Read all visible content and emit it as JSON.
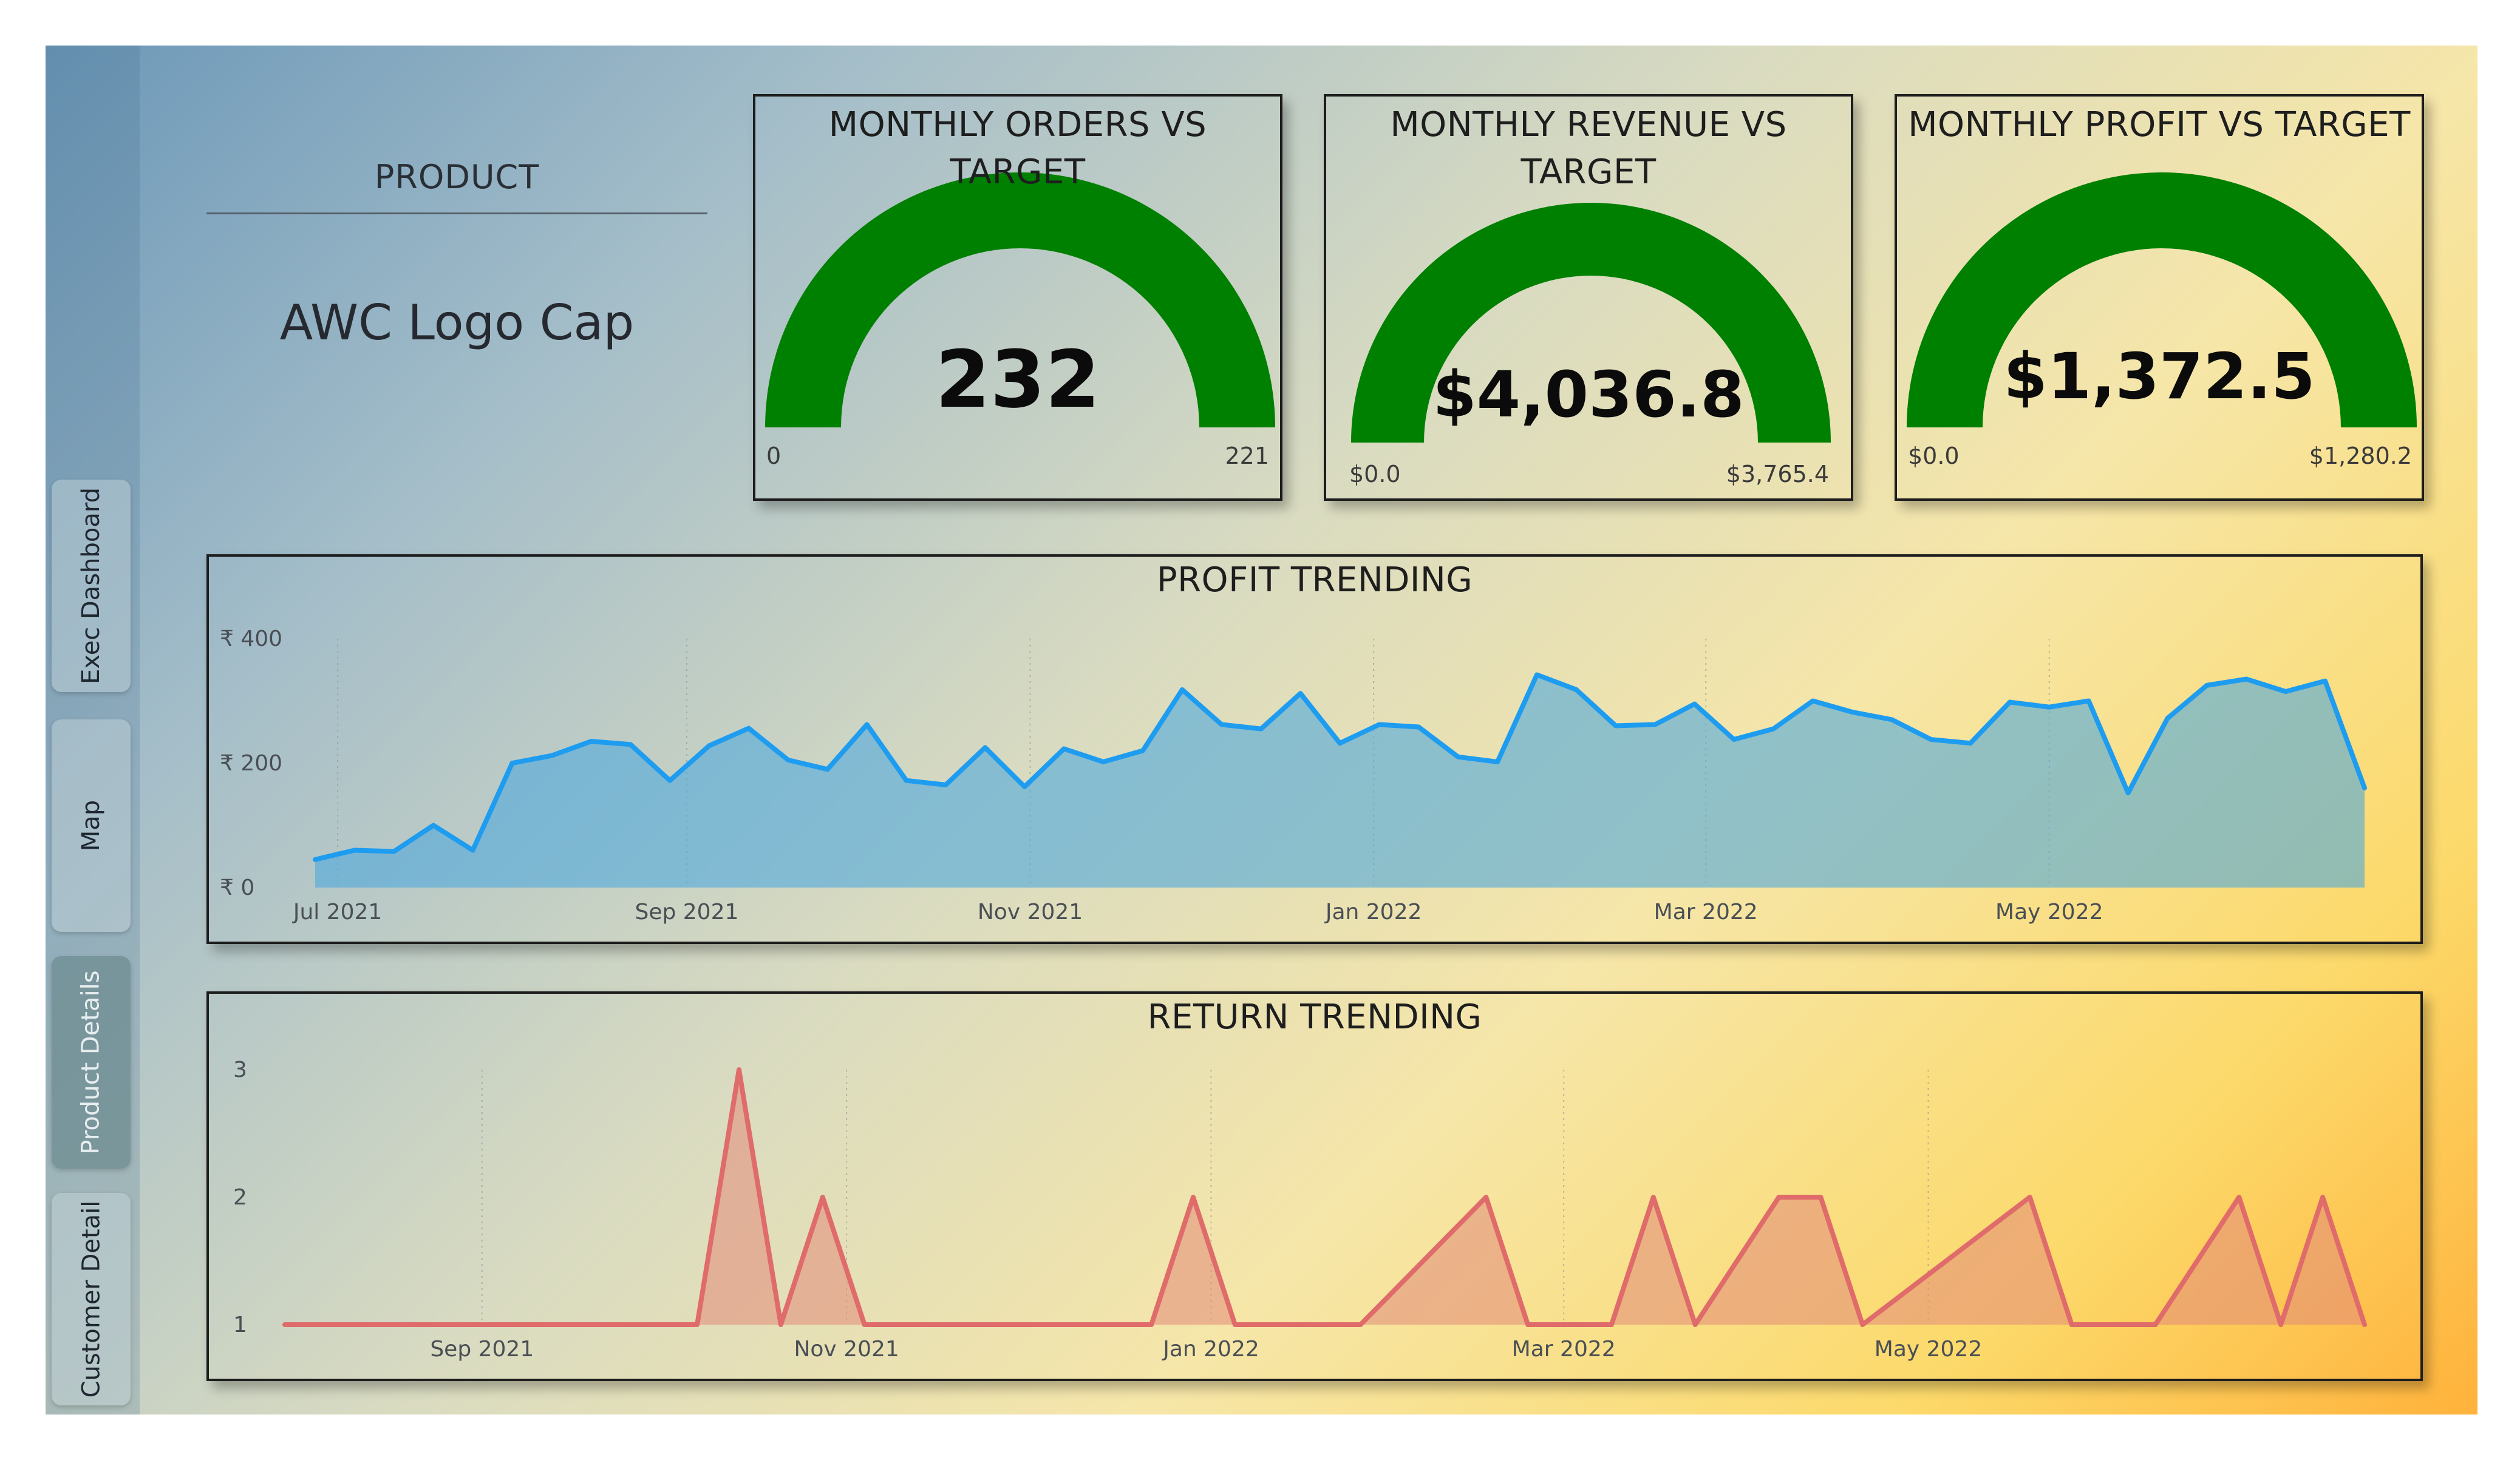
{
  "nav": {
    "items": [
      {
        "label": "Exec Dashboard",
        "active": false
      },
      {
        "label": "Map",
        "active": false
      },
      {
        "label": "Product Details",
        "active": true
      },
      {
        "label": "Customer Detail",
        "active": false
      }
    ]
  },
  "product": {
    "label": "PRODUCT",
    "value": "AWC Logo Cap"
  },
  "gauges": [
    {
      "title": "MONTHLY ORDERS VS TARGET",
      "value_text": "232",
      "min_text": "0",
      "max_text": "221",
      "fill_fraction": 1.0,
      "color": "#008000"
    },
    {
      "title": "MONTHLY REVENUE VS TARGET",
      "value_text": "$4,036.8",
      "min_text": "$0.0",
      "max_text": "$3,765.4",
      "fill_fraction": 1.0,
      "color": "#008000"
    },
    {
      "title": "MONTHLY PROFIT VS TARGET",
      "value_text": "$1,372.5",
      "min_text": "$0.0",
      "max_text": "$1,280.2",
      "fill_fraction": 1.0,
      "color": "#008000"
    }
  ],
  "chart_data": [
    {
      "type": "area",
      "title": "PROFIT TRENDING",
      "xlabel": "",
      "ylabel": "",
      "line_color": "#1e9cf0",
      "x_ticks": [
        "Jul 2021",
        "Sep 2021",
        "Nov 2021",
        "Jan 2022",
        "Mar 2022",
        "May 2022"
      ],
      "y_ticks": [
        "₹ 0",
        "₹ 200",
        "₹ 400"
      ],
      "ylim": [
        0,
        400
      ],
      "x": [
        "2021-06-27",
        "2021-07-04",
        "2021-07-11",
        "2021-07-18",
        "2021-07-25",
        "2021-08-01",
        "2021-08-08",
        "2021-08-15",
        "2021-08-22",
        "2021-08-29",
        "2021-09-05",
        "2021-09-12",
        "2021-09-19",
        "2021-09-26",
        "2021-10-03",
        "2021-10-10",
        "2021-10-17",
        "2021-10-24",
        "2021-10-31",
        "2021-11-07",
        "2021-11-14",
        "2021-11-21",
        "2021-11-28",
        "2021-12-05",
        "2021-12-12",
        "2021-12-19",
        "2021-12-26",
        "2022-01-02",
        "2022-01-09",
        "2022-01-16",
        "2022-01-23",
        "2022-01-30",
        "2022-02-06",
        "2022-02-13",
        "2022-02-20",
        "2022-02-27",
        "2022-03-06",
        "2022-03-13",
        "2022-03-20",
        "2022-03-27",
        "2022-04-03",
        "2022-04-10",
        "2022-04-17",
        "2022-04-24",
        "2022-05-01",
        "2022-05-08",
        "2022-05-15",
        "2022-05-22",
        "2022-05-29",
        "2022-06-05",
        "2022-06-12",
        "2022-06-19",
        "2022-06-26"
      ],
      "values": [
        45,
        60,
        58,
        100,
        60,
        200,
        212,
        235,
        230,
        172,
        228,
        256,
        205,
        190,
        262,
        172,
        165,
        225,
        162,
        223,
        202,
        220,
        318,
        262,
        255,
        312,
        232,
        262,
        258,
        210,
        202,
        342,
        318,
        260,
        262,
        295,
        238,
        255,
        300,
        282,
        270,
        238,
        232,
        298,
        290,
        300,
        152,
        272,
        325,
        335,
        315,
        332,
        160
      ]
    },
    {
      "type": "area",
      "title": "RETURN TRENDING",
      "xlabel": "",
      "ylabel": "",
      "line_color": "#e06b6b",
      "x_ticks": [
        "Sep 2021",
        "Nov 2021",
        "Jan 2022",
        "Mar 2022",
        "May 2022"
      ],
      "y_ticks": [
        "1",
        "2",
        "3"
      ],
      "ylim": [
        1,
        3
      ],
      "x": [
        "2021-07-30",
        "2021-10-07",
        "2021-10-14",
        "2021-10-21",
        "2021-10-28",
        "2021-11-04",
        "2021-12-22",
        "2021-12-29",
        "2022-01-05",
        "2022-01-26",
        "2022-02-16",
        "2022-02-23",
        "2022-03-09",
        "2022-03-16",
        "2022-03-23",
        "2022-04-06",
        "2022-04-13",
        "2022-04-20",
        "2022-05-18",
        "2022-05-25",
        "2022-06-08",
        "2022-06-22",
        "2022-06-29",
        "2022-07-06",
        "2022-07-13"
      ],
      "values": [
        1,
        1,
        3,
        1,
        2,
        1,
        1,
        2,
        1,
        1,
        2,
        1,
        1,
        2,
        1,
        2,
        2,
        1,
        2,
        1,
        1,
        2,
        1,
        2,
        1
      ]
    }
  ]
}
